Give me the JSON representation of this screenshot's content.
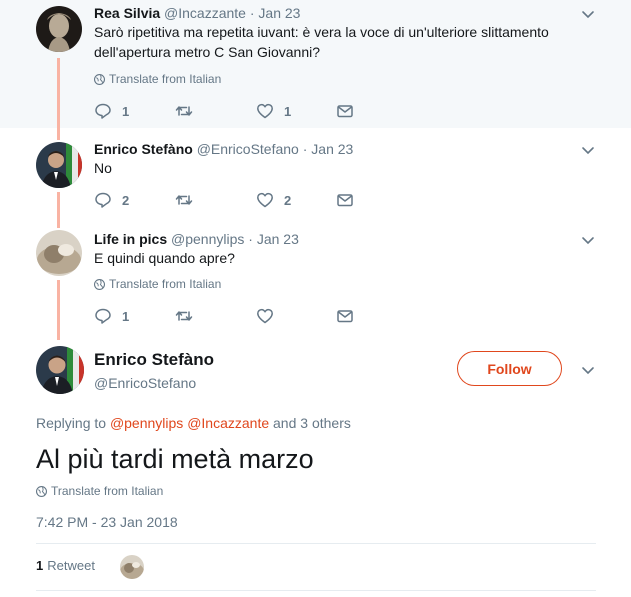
{
  "thread": [
    {
      "name": "Rea Silvia",
      "handle": "@Incazzante",
      "separator": "·",
      "date": "Jan 23",
      "text": "Sarò ripetitiva ma repetita iuvant: è vera la voce di un'ulteriore slittamento dell'apertura metro C San Giovanni?",
      "translate": "Translate from Italian",
      "replies": "1",
      "retweets": "",
      "likes": "1",
      "avatar_icon": "statue-avatar"
    },
    {
      "name": "Enrico Stefàno",
      "handle": "@EnricoStefano",
      "separator": "·",
      "date": "Jan 23",
      "text": "No",
      "replies": "2",
      "retweets": "",
      "likes": "2",
      "avatar_icon": "portrait-avatar"
    },
    {
      "name": "Life in pics",
      "handle": "@pennylips",
      "separator": "·",
      "date": "Jan 23",
      "text": "E quindi quando apre?",
      "translate": "Translate from Italian",
      "replies": "1",
      "retweets": "",
      "likes": "",
      "avatar_icon": "photo-avatar"
    }
  ],
  "main_tweet": {
    "name": "Enrico Stefàno",
    "handle": "@EnricoStefano",
    "follow_label": "Follow",
    "replying_prefix": "Replying to",
    "mention_1": "@pennylips",
    "mention_2": "@Incazzante",
    "replying_suffix": "and 3 others",
    "text": "Al più tardi metà marzo",
    "translate": "Translate from Italian",
    "timestamp": "7:42 PM - 23 Jan 2018",
    "retweet_count": "1",
    "retweet_label": "Retweet"
  },
  "colors": {
    "accent": "#e0471d",
    "muted": "#657786",
    "thread_line": "#f9b3a3",
    "context_bg": "#f5f8fa"
  }
}
